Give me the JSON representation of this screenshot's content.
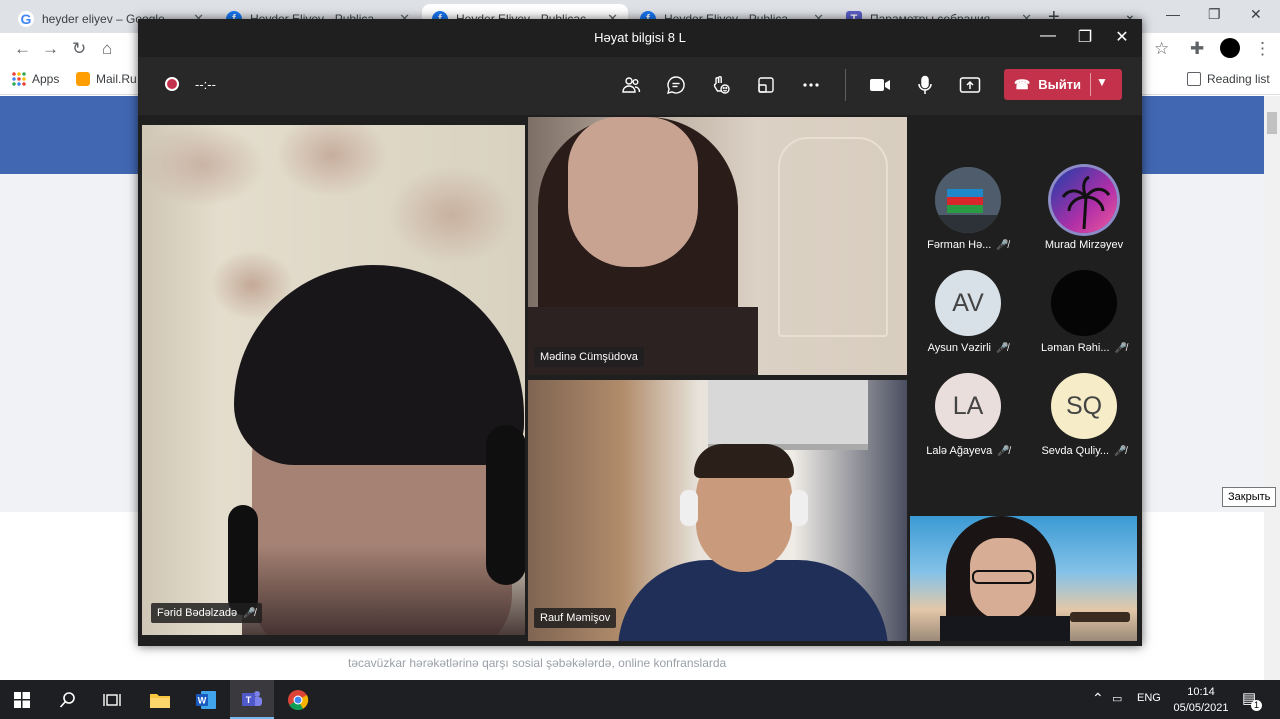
{
  "browser": {
    "tabs": [
      {
        "label": "heyder eliyev – Google Поиск",
        "icon": "google-icon"
      },
      {
        "label": "Heyder Eliyev - Publicações",
        "icon": "facebook-icon"
      },
      {
        "label": "Heyder Eliyev - Publicações",
        "icon": "facebook-icon"
      },
      {
        "label": "Heyder Eliyev - Publicações",
        "icon": "facebook-icon"
      },
      {
        "label": "Параметры собрания",
        "icon": "teams-icon"
      }
    ],
    "bookmarks": [
      {
        "label": "Apps"
      },
      {
        "label": "Mail.Ru"
      }
    ],
    "reading_list": "Reading list",
    "page_text": "təcavüzkar hərəkətlərinə qarşı sosial şəbəkələrdə, online konfranslarda",
    "tooltip": "Закрыть"
  },
  "teams": {
    "title": "Həyat bilgisi 8 L",
    "timer": "--:--",
    "leave_label": "Выйти",
    "videos": [
      {
        "name": "Fərid Bədəlzadə",
        "muted": true
      },
      {
        "name": "Mədinə Cümşüdova",
        "muted": false
      },
      {
        "name": "Rauf Məmişov",
        "muted": false
      }
    ],
    "participants": [
      {
        "name": "Fərman Hə...",
        "initials": "",
        "avatar_bg": "#5d6b7a",
        "muted": true,
        "speaking": false
      },
      {
        "name": "Murad Mirzəyev",
        "initials": "",
        "avatar_bg": "#7a2f8c",
        "muted": false,
        "speaking": true
      },
      {
        "name": "Aysun Vəzirli",
        "initials": "AV",
        "avatar_bg": "#d8e1e8",
        "muted": true,
        "speaking": false
      },
      {
        "name": "Ləman Rəhi...",
        "initials": "",
        "avatar_bg": "#050505",
        "muted": true,
        "speaking": false
      },
      {
        "name": "Lalə Ağayeva",
        "initials": "LA",
        "avatar_bg": "#e9dedc",
        "muted": true,
        "speaking": false
      },
      {
        "name": "Sevda Quliy...",
        "initials": "SQ",
        "avatar_bg": "#f6ecc8",
        "muted": true,
        "speaking": false
      }
    ]
  },
  "taskbar": {
    "language": "ENG",
    "time": "10:14",
    "date": "05/05/2021",
    "notification_count": "1"
  },
  "colors": {
    "teams_bg": "#201f1f",
    "leave_red": "#c4314b",
    "fb_blue": "#4267b2",
    "taskbar": "#1e1f23"
  }
}
